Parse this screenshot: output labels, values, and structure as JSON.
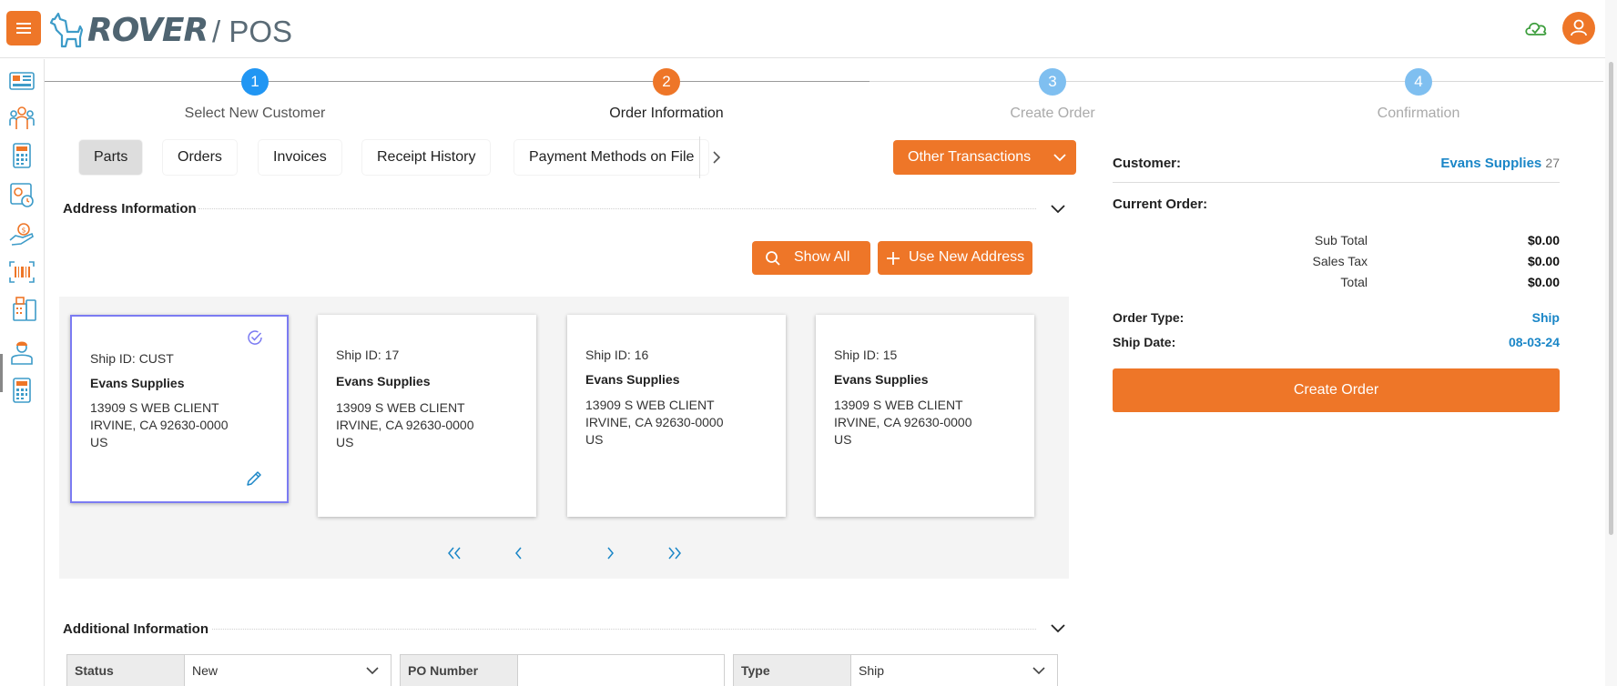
{
  "header": {
    "logo_brand": "ROVER",
    "logo_suffix": "/ POS"
  },
  "stepper": [
    {
      "num": "1",
      "label": "Select New Customer",
      "state": "done"
    },
    {
      "num": "2",
      "label": "Order Information",
      "state": "active"
    },
    {
      "num": "3",
      "label": "Create Order",
      "state": "pending"
    },
    {
      "num": "4",
      "label": "Confirmation",
      "state": "pending"
    }
  ],
  "tabs": [
    "Parts",
    "Orders",
    "Invoices",
    "Receipt History",
    "Payment Methods on File"
  ],
  "other_transactions": "Other Transactions",
  "address_section": {
    "title": "Address Information",
    "show_all": "Show All",
    "use_new": "Use New Address",
    "cards": [
      {
        "ship_id": "Ship ID: CUST",
        "name": "Evans Supplies",
        "line1": "13909 S WEB CLIENT",
        "line2": "IRVINE, CA 92630-0000",
        "line3": "US",
        "selected": true
      },
      {
        "ship_id": "Ship ID: 17",
        "name": "Evans Supplies",
        "line1": "13909 S WEB CLIENT",
        "line2": "IRVINE, CA 92630-0000",
        "line3": "US",
        "selected": false
      },
      {
        "ship_id": "Ship ID: 16",
        "name": "Evans Supplies",
        "line1": "13909 S WEB CLIENT",
        "line2": "IRVINE, CA 92630-0000",
        "line3": "US",
        "selected": false
      },
      {
        "ship_id": "Ship ID: 15",
        "name": "Evans Supplies",
        "line1": "13909 S WEB CLIENT",
        "line2": "IRVINE, CA 92630-0000",
        "line3": "US",
        "selected": false
      }
    ]
  },
  "additional_section": {
    "title": "Additional Information",
    "fields": [
      {
        "label": "Status",
        "value": "New"
      },
      {
        "label": "PO Number",
        "value": ""
      },
      {
        "label": "Type",
        "value": "Ship"
      }
    ]
  },
  "summary": {
    "customer_label": "Customer:",
    "customer_name": "Evans Supplies",
    "customer_id": "27",
    "current_order_label": "Current Order:",
    "subtotal_label": "Sub Total",
    "subtotal": "$0.00",
    "tax_label": "Sales Tax",
    "tax": "$0.00",
    "total_label": "Total",
    "total": "$0.00",
    "order_type_label": "Order Type:",
    "order_type": "Ship",
    "ship_date_label": "Ship Date:",
    "ship_date": "08-03-24",
    "create_order": "Create Order"
  },
  "colors": {
    "accent": "#ee7628",
    "step_done": "#2196f3",
    "step_pending": "#7fbff0",
    "link": "#1a86c7",
    "selected_border": "#7b7bf2"
  }
}
